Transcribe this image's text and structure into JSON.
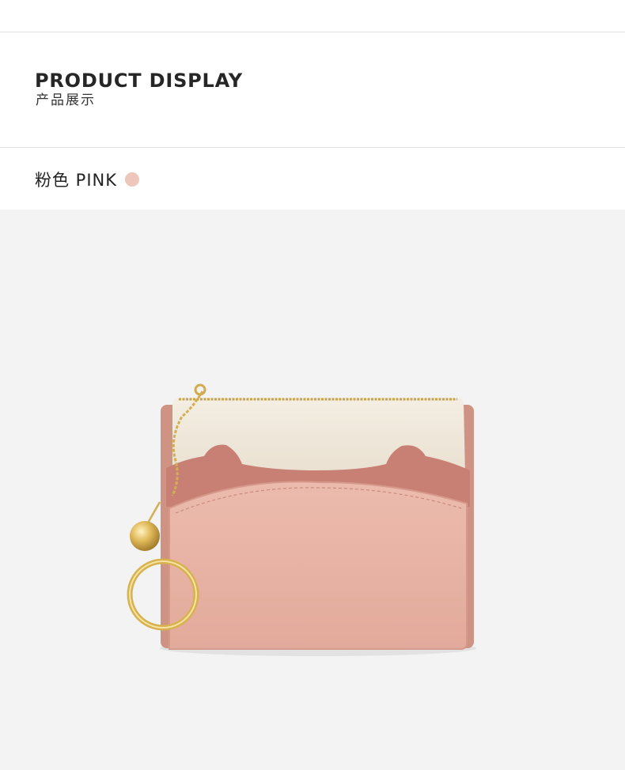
{
  "header": {
    "title": "PRODUCT DISPLAY",
    "subtitle": "产品展示"
  },
  "color_option": {
    "label": "粉色 PINK",
    "swatch_color": "#eec6bc"
  },
  "colors": {
    "background": "#ffffff",
    "photo_background": "#f3f3f3",
    "wallet_main": "#e6b0a2",
    "wallet_dark": "#c98074",
    "wallet_cream": "#efe8da",
    "hardware_gold": "#d9b45a"
  },
  "product_image": {
    "subject": "cat-ear card holder wallet with gold keyring and bell"
  }
}
